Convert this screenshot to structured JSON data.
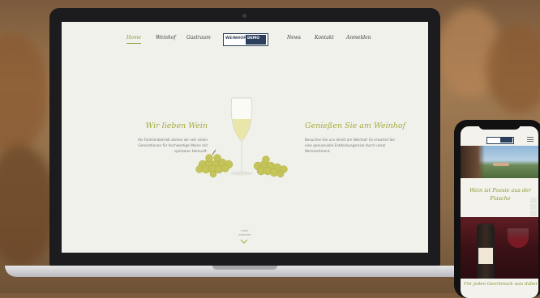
{
  "site": {
    "nav": {
      "items": [
        "Home",
        "Weinhof",
        "Gastraum",
        "News",
        "Kontakt",
        "Anmelden"
      ],
      "active": "Home"
    },
    "logo": {
      "left": "WEINHOF",
      "right": "DEMO"
    },
    "left": {
      "heading": "Wir lieben Wein",
      "text": "Als Familienbetrieb stehen wir seit vielen Generationen für hochwertige Weine mit spürbarer Herkunft."
    },
    "right": {
      "heading": "Genießen Sie am Weinhof",
      "text": "Besuchen Sie uns direkt am Weinhof. Es erwartet Sie eine genussvolle Entdeckungsreise durch unser Weinsortiment."
    },
    "more": {
      "line1": "mehr",
      "line2": "erfahren"
    }
  },
  "mobile": {
    "heading": "Wein ist Poesie aus der Flasche",
    "bottom_text": "Für jeden Geschmack was dabei"
  },
  "icons": {
    "side": [
      "mail-icon",
      "chat-icon",
      "facebook-icon",
      "location-icon",
      "phone-icon"
    ],
    "chevron": "chevron-down-icon"
  },
  "colors": {
    "accent": "#a3ac3f",
    "logo_blue": "#2b3f5c",
    "page_bg": "#f1f1ec"
  }
}
